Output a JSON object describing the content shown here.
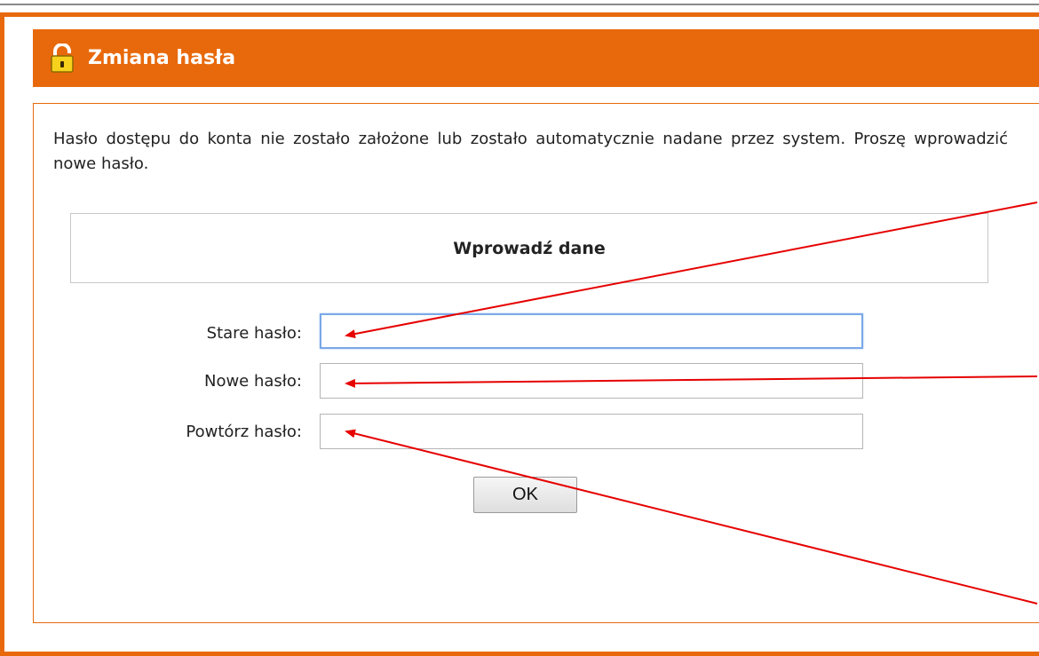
{
  "header": {
    "title": "Zmiana hasła",
    "icon": "unlocked-padlock-icon",
    "color": "#e8690c"
  },
  "info_text": "Hasło dostępu do konta nie zostało założone lub zostało automatycznie nadane przez system. Proszę wprowadzić nowe hasło.",
  "form": {
    "heading": "Wprowadź dane",
    "fields": [
      {
        "label": "Stare hasło:",
        "value": "",
        "focused": true
      },
      {
        "label": "Nowe hasło:",
        "value": ""
      },
      {
        "label": "Powtórz hasło:",
        "value": ""
      }
    ],
    "submit_label": "OK"
  },
  "annotation_color": "#e60000"
}
